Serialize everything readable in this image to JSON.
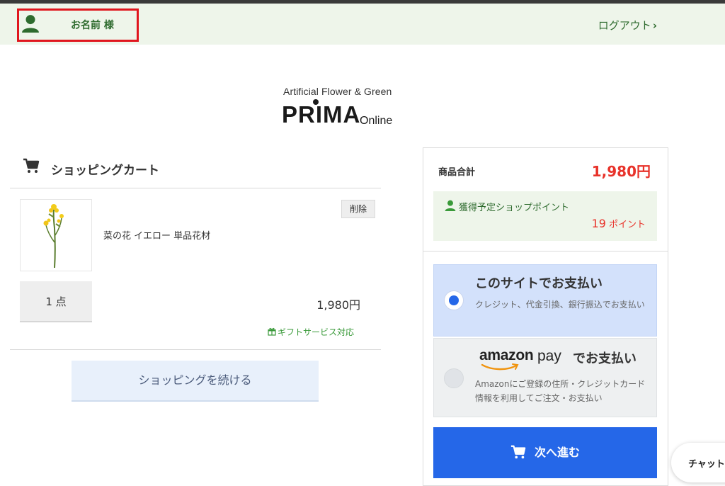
{
  "header": {
    "user_name": "お名前 様",
    "logout_label": "ログアウト",
    "logout_chevron": "›"
  },
  "logo": {
    "tagline": "Artificial Flower & Green",
    "brand": "PRIMA",
    "sub": "Online"
  },
  "cart": {
    "title": "ショッピングカート",
    "items": [
      {
        "name": "菜の花 イエロー 単品花材",
        "delete_label": "削除",
        "quantity": "1 点",
        "price": "1,980円",
        "gift": "ギフトサービス対応",
        "image_icon": "rapeseed-flower-image"
      }
    ],
    "continue_label": "ショッピングを続ける"
  },
  "summary": {
    "subtotal_label": "商品合計",
    "subtotal_value": "1,980円",
    "points_label": "獲得予定ショップポイント",
    "points_value": "19",
    "points_unit": "ポイント"
  },
  "payment": {
    "site": {
      "title": "このサイトでお支払い",
      "desc": "クレジット、代金引換、銀行振込でお支払い"
    },
    "amazon": {
      "logo_word": "amazon",
      "logo_pay": "pay",
      "title_suffix": "でお支払い",
      "desc": "Amazonにご登録の住所・クレジットカード情報を利用してご注文・お支払い"
    }
  },
  "next_label": "次へ進む",
  "chat_label": "チャット",
  "colors": {
    "accent_blue": "#2567e8",
    "price_red": "#e8332b",
    "header_green": "#2e6b2e",
    "highlight_red": "#e0161e"
  }
}
